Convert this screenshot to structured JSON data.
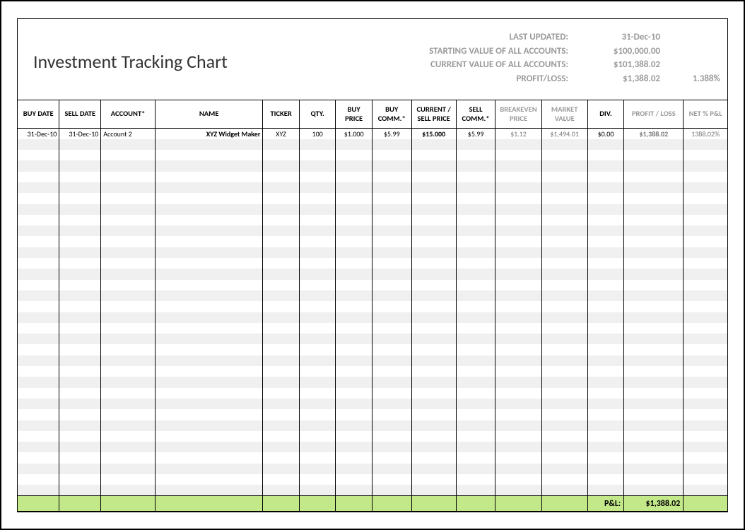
{
  "title": "Investment Tracking Chart",
  "summary": {
    "last_updated_label": "LAST UPDATED:",
    "last_updated_value": "31-Dec-10",
    "starting_value_label": "STARTING VALUE OF ALL ACCOUNTS:",
    "starting_value": "$100,000.00",
    "current_value_label": "CURRENT VALUE OF ALL ACCOUNTS:",
    "current_value": "$101,388.02",
    "profit_loss_label": "PROFIT/LOSS:",
    "profit_loss_value": "$1,388.02",
    "profit_loss_pct": "1.388%"
  },
  "columns": {
    "buy_date": "BUY DATE",
    "sell_date": "SELL DATE",
    "account": "ACCOUNT*",
    "name": "NAME",
    "ticker": "TICKER",
    "qty": "QTY.",
    "buy_price": "BUY PRICE",
    "buy_comm": "BUY COMM.*",
    "current_sell_price": "CURRENT / SELL PRICE",
    "sell_comm": "SELL COMM.*",
    "breakeven_price": "BREAKEVEN PRICE",
    "market_value": "MARKET VALUE",
    "div": "DIV.",
    "profit_loss": "PROFIT / LOSS",
    "net_pct_pl": "NET % P&L"
  },
  "rows": [
    {
      "buy_date": "31-Dec-10",
      "sell_date": "31-Dec-10",
      "account": "Account 2",
      "name": "XYZ Widget Maker",
      "ticker": "XYZ",
      "qty": "100",
      "buy_price": "$1.000",
      "buy_comm": "$5.99",
      "current_sell_price": "$15.000",
      "sell_comm": "$5.99",
      "breakeven_price": "$1.12",
      "market_value": "$1,494.01",
      "div": "$0.00",
      "profit_loss": "$1,388.02",
      "net_pct_pl": "1388.02%"
    }
  ],
  "empty_rows": 33,
  "footer": {
    "pl_label": "P&L:",
    "pl_value": "$1,388.02"
  }
}
